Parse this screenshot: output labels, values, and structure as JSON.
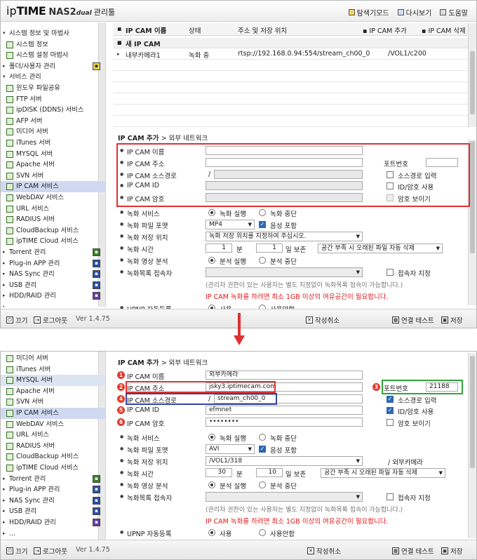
{
  "top": {
    "logo_ip": "ip",
    "logo_time": "TIME",
    "logo_nas": "NAS2",
    "logo_dual": "dual",
    "logo_admin": "관리툴",
    "links": [
      "탐색기모드",
      "다시보기",
      "도움말"
    ]
  },
  "sidebar_top": [
    {
      "label": "시스템 정보 및 마법사",
      "kind": "group"
    },
    {
      "label": "시스템 정보",
      "kind": "sub"
    },
    {
      "label": "시스템 설정 마법사",
      "kind": "sub"
    },
    {
      "label": "폴더/사용자 관리",
      "kind": "top"
    },
    {
      "label": "서비스 관리",
      "kind": "group"
    },
    {
      "label": "윈도우 파일공유",
      "kind": "sub"
    },
    {
      "label": "FTP 서버",
      "kind": "sub"
    },
    {
      "label": "ipDISK (DDNS) 서비스",
      "kind": "sub"
    },
    {
      "label": "AFP 서버",
      "kind": "sub"
    },
    {
      "label": "미디어 서버",
      "kind": "sub"
    },
    {
      "label": "iTunes 서버",
      "kind": "sub"
    },
    {
      "label": "MYSQL 서버",
      "kind": "sub"
    },
    {
      "label": "Apache 서버",
      "kind": "sub"
    },
    {
      "label": "SVN 서버",
      "kind": "sub"
    },
    {
      "label": "IP CAM 서비스",
      "kind": "sub",
      "selected": true
    },
    {
      "label": "WebDAV 서비스",
      "kind": "sub"
    },
    {
      "label": "URL 서비스",
      "kind": "sub"
    },
    {
      "label": "RADIUS 서버",
      "kind": "sub"
    },
    {
      "label": "CloudBackup 서비스",
      "kind": "sub"
    },
    {
      "label": "ipTIME Cloud 서비스",
      "kind": "sub"
    },
    {
      "label": "Torrent 관리",
      "kind": "top"
    },
    {
      "label": "Plug-in APP 관리",
      "kind": "top"
    },
    {
      "label": "NAS Sync 관리",
      "kind": "top"
    },
    {
      "label": "USB 관리",
      "kind": "top"
    },
    {
      "label": "HDD/RAID 관리",
      "kind": "top"
    },
    {
      "label": "...",
      "kind": "top"
    }
  ],
  "sidebar_bottom": [
    {
      "label": "미디어 서버",
      "kind": "sub"
    },
    {
      "label": "iTunes 서버",
      "kind": "sub"
    },
    {
      "label": "MYSQL 서버",
      "kind": "sub",
      "hover": true
    },
    {
      "label": "Apache 서버",
      "kind": "sub"
    },
    {
      "label": "SVN 서버",
      "kind": "sub"
    },
    {
      "label": "IP CAM 서비스",
      "kind": "sub",
      "selected": true
    },
    {
      "label": "WebDAV 서비스",
      "kind": "sub"
    },
    {
      "label": "URL 서비스",
      "kind": "sub"
    },
    {
      "label": "RADIUS 서버",
      "kind": "sub"
    },
    {
      "label": "CloudBackup 서비스",
      "kind": "sub"
    },
    {
      "label": "ipTIME Cloud 서비스",
      "kind": "sub"
    },
    {
      "label": "Torrent 관리",
      "kind": "top"
    },
    {
      "label": "Plug-in APP 관리",
      "kind": "top"
    },
    {
      "label": "NAS Sync 관리",
      "kind": "top"
    },
    {
      "label": "USB 관리",
      "kind": "top"
    },
    {
      "label": "HDD/RAID 관리",
      "kind": "top"
    },
    {
      "label": "...",
      "kind": "top"
    }
  ],
  "bottombar": {
    "off": "끄기",
    "logout": "로그아웃",
    "version": "Ver 1.4.75",
    "cancel": "작성취소",
    "test": "연결 테스트",
    "save": "저장"
  },
  "list": {
    "headers": [
      "IP CAM 이름",
      "상태",
      "주소 및 저장 위치"
    ],
    "add": "IP CAM 추가",
    "delete": "IP CAM 삭제",
    "new_row": "새 IP CAM",
    "rows": [
      {
        "name": "내부카메라1",
        "status": "녹화 중",
        "address": "rtsp://192.168.0.94:554/stream_ch00_0",
        "path": "/VOL1/c200"
      }
    ]
  },
  "form": {
    "section": "IP CAM 추가",
    "crumb": "> 외부 네트워크",
    "labels": {
      "name": "IP CAM 이름",
      "addr": "IP CAM 주소",
      "src": "IP CAM 소스경로",
      "id": "IP CAM ID",
      "pw": "IP CAM 암호",
      "port": "포트번호",
      "src_input": "소스경로 입력",
      "idpw_use": "ID/암호 사용",
      "pw_show": "암호 보이기",
      "rec_service": "녹화 서비스",
      "rec_run": "녹화 실행",
      "rec_stop": "녹화 중단",
      "file_format": "녹화 파일 포맷",
      "audio": "음성 포함",
      "save_loc": "녹화 저장 위치",
      "rec_time": "녹화 시간",
      "min": "분",
      "day_keep": "일 보존",
      "analysis": "녹화 영상 분석",
      "analysis_run": "분석 실행",
      "analysis_stop": "분석 중단",
      "access": "녹화목록 접속자",
      "access_set": "접속자 지정",
      "upnp": "UPNP 자동등록",
      "use": "사용",
      "nouse": "사용안함",
      "slash": "/"
    },
    "note": "(관리자 권한이 있는 사용자는 별도 지정없이 녹화목록 접속이 가능합니다.)",
    "warning": "IP CAM 녹화를 하려면 최소 1GB 이상의 여유공간이 필요합니다.",
    "auto_delete": "공간 부족 시 오래된 파일 자동 삭제"
  },
  "form_top": {
    "name": "",
    "addr": "",
    "src": "",
    "id": "",
    "pw": "",
    "port": "",
    "format": "MP4",
    "save_loc": "녹화 저장 위치를 지정하여 주십시오.",
    "rec_min": "1",
    "keep_day": "1"
  },
  "form_bottom": {
    "name": "외부카메라",
    "addr": "jsky3.iptimecam.com",
    "src": "stream_ch00_0",
    "id": "efmnet",
    "pw": "••••••••",
    "port": "21188",
    "format": "AVI",
    "save_loc": "/VOL1/318",
    "save_suffix": "/ 외부카메라",
    "rec_min": "30",
    "keep_day": "10",
    "markers": [
      "1",
      "2",
      "3",
      "4",
      "5",
      "6"
    ]
  }
}
